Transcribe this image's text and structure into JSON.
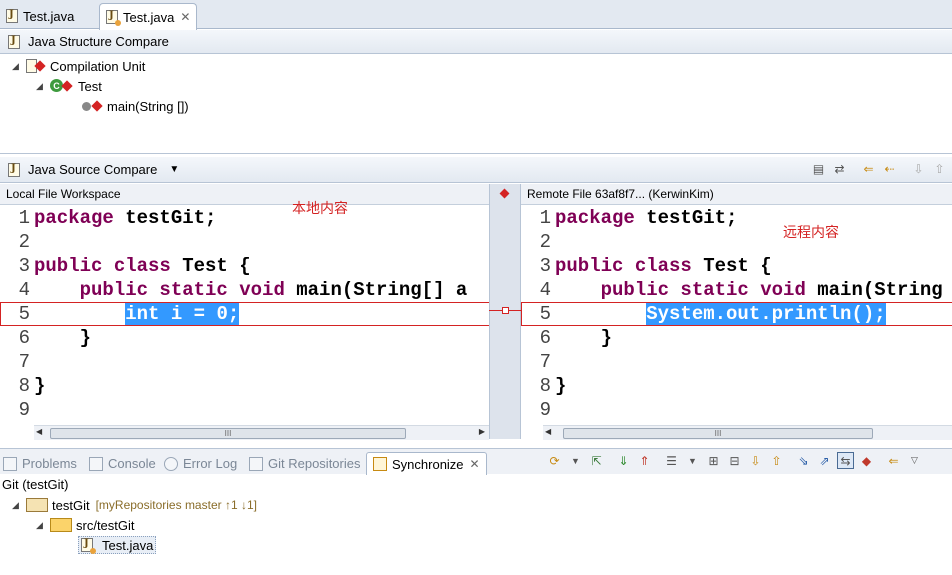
{
  "editor_tabs": [
    {
      "label": "Test.java"
    },
    {
      "label": "Test.java",
      "close": "✕"
    }
  ],
  "structure": {
    "title": "Java Structure Compare",
    "tree": {
      "root": "Compilation Unit",
      "class": "Test",
      "method": "main(String [])"
    }
  },
  "source": {
    "title": "Java Source Compare",
    "left_header": "Local File Workspace",
    "right_header": "Remote File 63af8f7... (KerwinKim)",
    "left_annotation": "本地内容",
    "right_annotation": "远程内容",
    "line_numbers": [
      "1",
      "2",
      "3",
      "4",
      "5",
      "6",
      "7",
      "8",
      "9"
    ],
    "left_lines": [
      [
        "package",
        " testGit;"
      ],
      [
        "",
        ""
      ],
      [
        "public class",
        " Test {"
      ],
      [
        "    public static void",
        " main(String[] a"
      ],
      [
        "        int",
        " i = 0;"
      ],
      [
        "    ",
        "}"
      ],
      [
        "",
        ""
      ],
      [
        "",
        "}"
      ],
      [
        "",
        ""
      ]
    ],
    "right_lines": [
      [
        "package",
        " testGit;"
      ],
      [
        "",
        ""
      ],
      [
        "public class",
        " Test {"
      ],
      [
        "    public static void",
        " main(String"
      ],
      [
        "        ",
        "System.out.println();"
      ],
      [
        "    ",
        "}"
      ],
      [
        "",
        ""
      ],
      [
        "",
        "}"
      ],
      [
        "",
        ""
      ]
    ],
    "scroll_thumb": "III"
  },
  "views": {
    "tabs": [
      "Problems",
      "Console",
      "Error Log",
      "Git Repositories",
      "Synchronize"
    ],
    "active_close": "✕",
    "context": "Git (testGit)",
    "sync_tree": {
      "project": "testGit",
      "project_meta": "[myRepositories master ↑1 ↓1]",
      "folder": "src/testGit",
      "file": "Test.java"
    }
  },
  "colors": {
    "keyword": "#7f0055",
    "selection": "#3399ff",
    "diff_border": "#d42323"
  }
}
